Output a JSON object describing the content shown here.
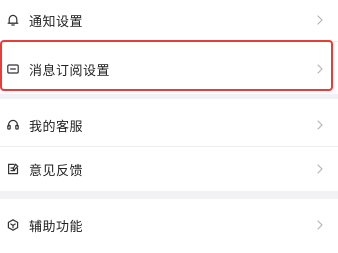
{
  "settings_list": {
    "group_notifications": {
      "items": [
        {
          "label": "通知设置",
          "icon": "bell-icon"
        },
        {
          "label": "消息订阅设置",
          "icon": "message-box-icon"
        }
      ]
    },
    "group_support": {
      "items": [
        {
          "label": "我的客服",
          "icon": "headset-icon"
        },
        {
          "label": "意见反馈",
          "icon": "feedback-icon"
        }
      ]
    },
    "group_accessibility": {
      "items": [
        {
          "label": "辅助功能",
          "icon": "accessibility-icon"
        }
      ]
    }
  },
  "colors": {
    "page_background": "#f2f2f5",
    "row_background": "#ffffff",
    "text": "#222222",
    "icon": "#333333",
    "chevron": "#b5b5b8",
    "highlight_border": "#e43d3a"
  }
}
